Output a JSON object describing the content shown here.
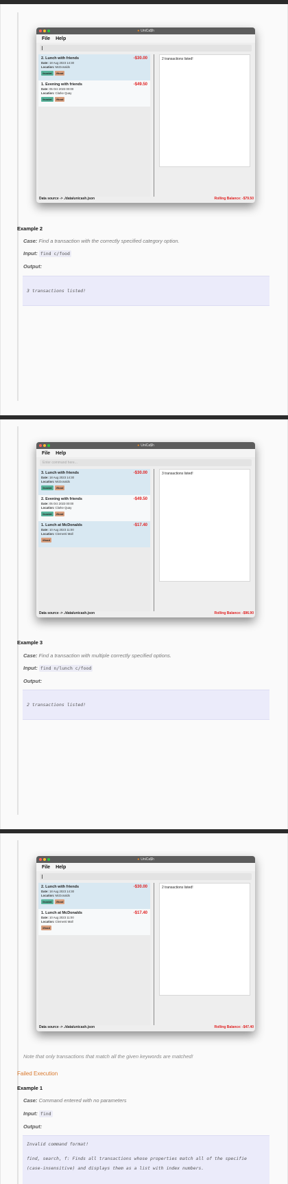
{
  "app": {
    "title": "UniCa$h",
    "menu": [
      "File",
      "Help"
    ],
    "command_placeholder": "Enter command here...",
    "status_left": "Data source -> ./data/unicash.json"
  },
  "screens": [
    {
      "result": "2 transactions listed!",
      "balance": "Rolling Balance: -$79.50",
      "transactions": [
        {
          "name": "2. Lunch with friends",
          "amount": "-$30.00",
          "date_label": "Date:",
          "date": "18 Aug 2023 14:30",
          "loc_label": "Location:",
          "location": "McDonalds",
          "tags": [
            "#social",
            "#food"
          ]
        },
        {
          "name": "1. Evening with friends",
          "amount": "-$49.50",
          "date_label": "Date:",
          "date": "05 Oct 2023 00:00",
          "loc_label": "Location:",
          "location": "Clarke Quay",
          "tags": [
            "#social",
            "#food"
          ]
        }
      ]
    },
    {
      "result": "3 transactions listed!",
      "balance": "Rolling Balance: -$96.90",
      "transactions": [
        {
          "name": "3. Lunch with friends",
          "amount": "-$30.00",
          "date_label": "Date:",
          "date": "18 Aug 2023 14:30",
          "loc_label": "Location:",
          "location": "McDonalds",
          "tags": [
            "#social",
            "#food"
          ]
        },
        {
          "name": "2. Evening with friends",
          "amount": "-$49.50",
          "date_label": "Date:",
          "date": "05 Oct 2023 00:00",
          "loc_label": "Location:",
          "location": "Clarke Quay",
          "tags": [
            "#social",
            "#food"
          ]
        },
        {
          "name": "1. Lunch at McDonalds",
          "amount": "-$17.40",
          "date_label": "Date:",
          "date": "10 Aug 2023 11:00",
          "loc_label": "Location:",
          "location": "Clementi Mall",
          "tags": [
            "#food"
          ]
        }
      ]
    },
    {
      "result": "2 transactions listed!",
      "balance": "Rolling Balance: -$47.40",
      "transactions": [
        {
          "name": "2. Lunch with friends",
          "amount": "-$30.00",
          "date_label": "Date:",
          "date": "18 Aug 2023 14:30",
          "loc_label": "Location:",
          "location": "McDonalds",
          "tags": [
            "#social",
            "#food"
          ]
        },
        {
          "name": "1. Lunch at McDonalds",
          "amount": "-$17.40",
          "date_label": "Date:",
          "date": "10 Aug 2023 11:00",
          "loc_label": "Location:",
          "location": "Clementi Mall",
          "tags": [
            "#food"
          ]
        }
      ]
    }
  ],
  "doc": {
    "example2": {
      "heading": "Example 2",
      "case_label": "Case:",
      "case": "Find a transaction with the correctly specified category option.",
      "input_label": "Input:",
      "input": "find c/food",
      "output_label": "Output:",
      "output": "3 transactions listed!"
    },
    "example3": {
      "heading": "Example 3",
      "case_label": "Case:",
      "case": "Find a transaction with multiple correctly specified options.",
      "input_label": "Input:",
      "input": "find n/lunch c/food",
      "output_label": "Output:",
      "output": "2 transactions listed!"
    },
    "note": "Note that only transactions that match all the given keywords are matched!",
    "failed_heading": "Failed Execution",
    "failed_example1": {
      "heading": "Example 1",
      "case_label": "Case:",
      "case": "Command entered with no parameters",
      "input_label": "Input:",
      "input": "find",
      "output_label": "Output:",
      "output_line1": "Invalid command format!",
      "output_line2": "find, search, f: Finds all transactions whose properties match all of the specifie",
      "output_line3": "(case-insensitive) and displays them as a list with index numbers."
    }
  },
  "colors": {
    "amount": "#e02020",
    "tag_social": "#59b39b",
    "tag_food": "#d9a07f",
    "failed_heading": "#d9772a",
    "output_bg": "#ebebfa",
    "selected_card": "#d8e8f2"
  }
}
